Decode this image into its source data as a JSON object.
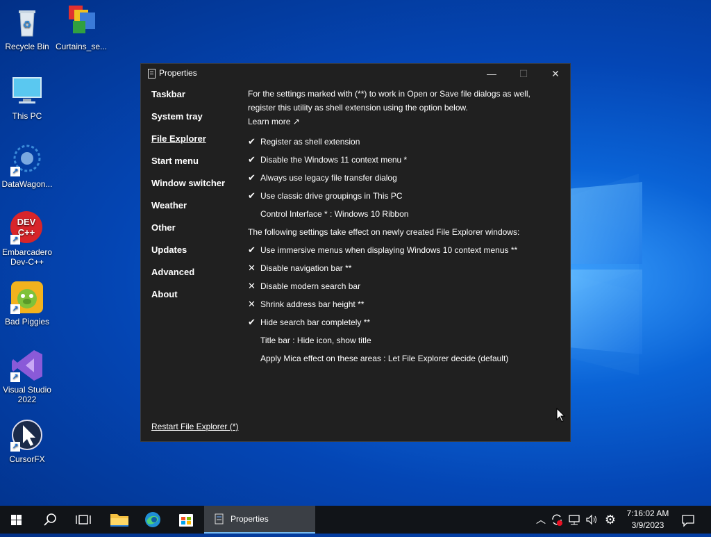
{
  "desktop": {
    "icons": [
      {
        "label": "Recycle Bin"
      },
      {
        "label": "Curtains_se..."
      },
      {
        "label": "This PC"
      },
      {
        "label": "DataWagon..."
      },
      {
        "label": "Embarcadero Dev-C++",
        "badge": "DEV C++"
      },
      {
        "label": "Bad Piggies"
      },
      {
        "label": "Visual Studio 2022"
      },
      {
        "label": "CursorFX"
      }
    ]
  },
  "window": {
    "title": "Properties",
    "controls": {
      "minimize": "—",
      "maximize": "☐",
      "close": "✕"
    },
    "nav": [
      {
        "label": "Taskbar"
      },
      {
        "label": "System tray"
      },
      {
        "label": "File Explorer"
      },
      {
        "label": "Start menu"
      },
      {
        "label": "Window switcher"
      },
      {
        "label": "Weather"
      },
      {
        "label": "Other"
      },
      {
        "label": "Updates"
      },
      {
        "label": "Advanced"
      },
      {
        "label": "About"
      }
    ],
    "active_nav": "File Explorer",
    "intro": "For the settings marked with (**) to work in Open or Save file dialogs as well, register this utility as shell extension using the option below.",
    "learn_more": "Learn more ↗",
    "settings_group1": [
      {
        "mark": "✔",
        "label": "Register as shell extension"
      },
      {
        "mark": "✔",
        "label": "Disable the Windows 11 context menu *"
      },
      {
        "mark": "✔",
        "label": "Always use legacy file transfer dialog"
      },
      {
        "mark": "✔",
        "label": "Use classic drive groupings in This PC"
      },
      {
        "mark": "",
        "label": "Control Interface * : Windows 10 Ribbon"
      }
    ],
    "section_note": "The following settings take effect on newly created File Explorer windows:",
    "settings_group2": [
      {
        "mark": "✔",
        "label": "Use immersive menus when displaying Windows 10 context menus **"
      },
      {
        "mark": "✕",
        "label": "Disable navigation bar **"
      },
      {
        "mark": "✕",
        "label": "Disable modern search bar"
      },
      {
        "mark": "✕",
        "label": "Shrink address bar height **"
      },
      {
        "mark": "✔",
        "label": "Hide search bar completely **"
      },
      {
        "mark": "",
        "label": "Title bar : Hide icon, show title"
      },
      {
        "mark": "",
        "label": "Apply Mica effect on these areas : Let File Explorer decide (default)"
      }
    ],
    "restart_link": "Restart File Explorer (*)"
  },
  "taskbar": {
    "active_app": "Properties",
    "clock_time": "7:16:02 AM",
    "clock_date": "3/9/2023"
  },
  "colors": {
    "window_bg": "#202020",
    "taskbar_bg": "#111418",
    "accent": "#76b9ed"
  }
}
